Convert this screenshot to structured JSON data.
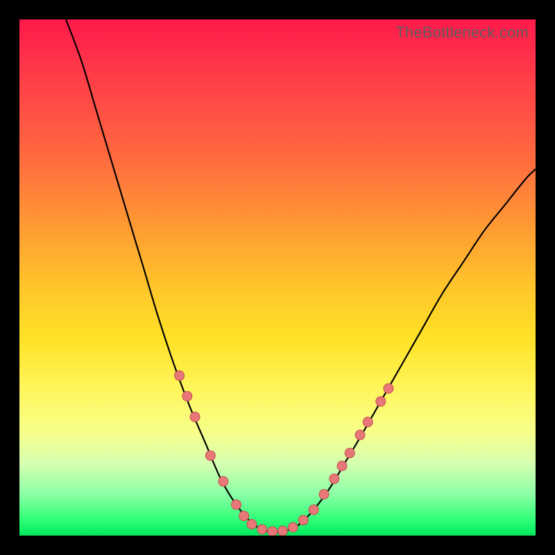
{
  "watermark": "TheBottleneck.com",
  "colors": {
    "curve": "#000000",
    "dot_fill": "#e87878",
    "dot_stroke": "#c24f4f"
  },
  "chart_data": {
    "type": "line",
    "title": "",
    "xlabel": "",
    "ylabel": "",
    "xlim": [
      0,
      100
    ],
    "ylim": [
      0,
      100
    ],
    "curve": [
      {
        "x": 9.0,
        "y": 100.0
      },
      {
        "x": 12.0,
        "y": 92.0
      },
      {
        "x": 15.0,
        "y": 82.0
      },
      {
        "x": 18.0,
        "y": 72.0
      },
      {
        "x": 21.0,
        "y": 62.0
      },
      {
        "x": 24.0,
        "y": 52.0
      },
      {
        "x": 27.0,
        "y": 42.0
      },
      {
        "x": 30.0,
        "y": 33.0
      },
      {
        "x": 33.0,
        "y": 25.0
      },
      {
        "x": 36.0,
        "y": 18.0
      },
      {
        "x": 39.0,
        "y": 11.0
      },
      {
        "x": 42.0,
        "y": 6.0
      },
      {
        "x": 45.0,
        "y": 2.5
      },
      {
        "x": 48.0,
        "y": 0.8
      },
      {
        "x": 51.0,
        "y": 0.8
      },
      {
        "x": 54.0,
        "y": 2.0
      },
      {
        "x": 57.0,
        "y": 5.0
      },
      {
        "x": 60.0,
        "y": 9.0
      },
      {
        "x": 63.0,
        "y": 14.0
      },
      {
        "x": 66.0,
        "y": 19.0
      },
      {
        "x": 70.0,
        "y": 26.0
      },
      {
        "x": 74.0,
        "y": 33.0
      },
      {
        "x": 78.0,
        "y": 40.0
      },
      {
        "x": 82.0,
        "y": 47.0
      },
      {
        "x": 86.0,
        "y": 53.0
      },
      {
        "x": 90.0,
        "y": 59.0
      },
      {
        "x": 94.0,
        "y": 64.0
      },
      {
        "x": 98.0,
        "y": 69.0
      },
      {
        "x": 100.0,
        "y": 71.0
      }
    ],
    "dots": [
      {
        "x": 31.0,
        "y": 31.0
      },
      {
        "x": 32.5,
        "y": 27.0
      },
      {
        "x": 34.0,
        "y": 23.0
      },
      {
        "x": 37.0,
        "y": 15.5
      },
      {
        "x": 39.5,
        "y": 10.5
      },
      {
        "x": 42.0,
        "y": 6.0
      },
      {
        "x": 43.5,
        "y": 3.8
      },
      {
        "x": 45.0,
        "y": 2.2
      },
      {
        "x": 47.0,
        "y": 1.2
      },
      {
        "x": 49.0,
        "y": 0.8
      },
      {
        "x": 51.0,
        "y": 0.9
      },
      {
        "x": 53.0,
        "y": 1.6
      },
      {
        "x": 55.0,
        "y": 3.0
      },
      {
        "x": 57.0,
        "y": 5.0
      },
      {
        "x": 59.0,
        "y": 8.0
      },
      {
        "x": 61.0,
        "y": 11.0
      },
      {
        "x": 62.5,
        "y": 13.5
      },
      {
        "x": 64.0,
        "y": 16.0
      },
      {
        "x": 66.0,
        "y": 19.5
      },
      {
        "x": 67.5,
        "y": 22.0
      },
      {
        "x": 70.0,
        "y": 26.0
      },
      {
        "x": 71.5,
        "y": 28.5
      }
    ],
    "dot_radius": 7
  }
}
